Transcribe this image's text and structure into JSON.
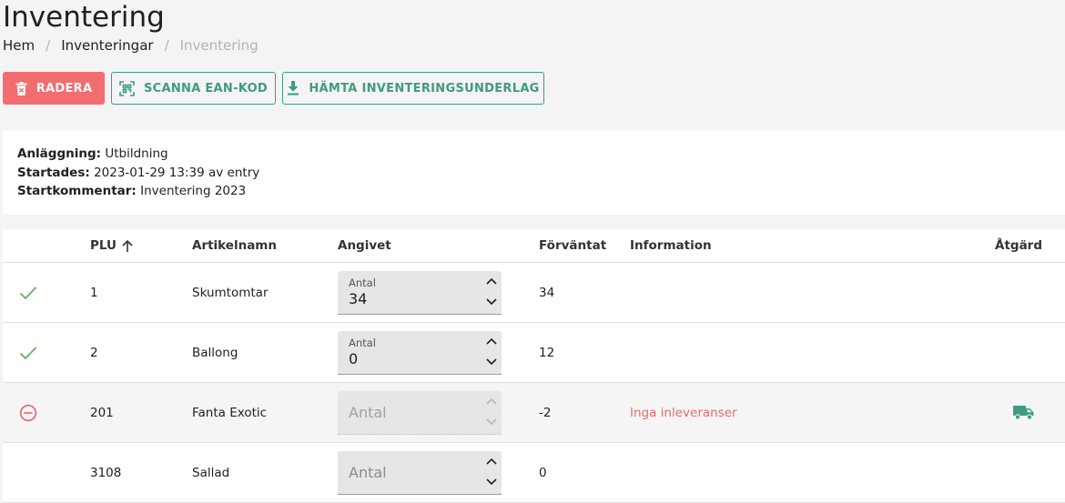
{
  "header": {
    "title": "Inventering"
  },
  "breadcrumb": {
    "items": [
      "Hem",
      "Inventeringar",
      "Inventering"
    ],
    "separator": "/"
  },
  "toolbar": {
    "delete_label": "RADERA",
    "scan_label": "SCANNA EAN-KOD",
    "fetch_label": "HÄMTA INVENTERINGSUNDERLAG"
  },
  "info": {
    "facility_label": "Anläggning:",
    "facility_value": "Utbildning",
    "started_label": "Startades:",
    "started_value": "2023-01-29 13:39 av entry",
    "comment_label": "Startkommentar:",
    "comment_value": "Inventering 2023"
  },
  "table": {
    "headers": {
      "plu": "PLU",
      "name": "Artikelnamn",
      "entered": "Angivet",
      "expected": "Förväntat",
      "info": "Information",
      "action": "Åtgärd"
    },
    "rows": [
      {
        "status": "check-icon",
        "plu": "1",
        "name": "Skumtomtar",
        "qty_label": "Antal",
        "qty_value": "34",
        "expected": "34",
        "info": ""
      },
      {
        "status": "check-icon",
        "plu": "2",
        "name": "Ballong",
        "qty_label": "Antal",
        "qty_value": "0",
        "expected": "12",
        "info": ""
      },
      {
        "status": "minus-circle-icon",
        "plu": "201",
        "name": "Fanta Exotic",
        "qty_placeholder": "Antal",
        "expected": "-2",
        "info": "Inga inleveranser",
        "action_icon": "truck-icon"
      },
      {
        "status": "",
        "plu": "3108",
        "name": "Sallad",
        "qty_placeholder": "Antal",
        "expected": "0",
        "info": ""
      }
    ]
  },
  "colors": {
    "danger": "#f26d6d",
    "primary": "#3e9b82",
    "success": "#5fb358",
    "error": "#e86a6a"
  }
}
